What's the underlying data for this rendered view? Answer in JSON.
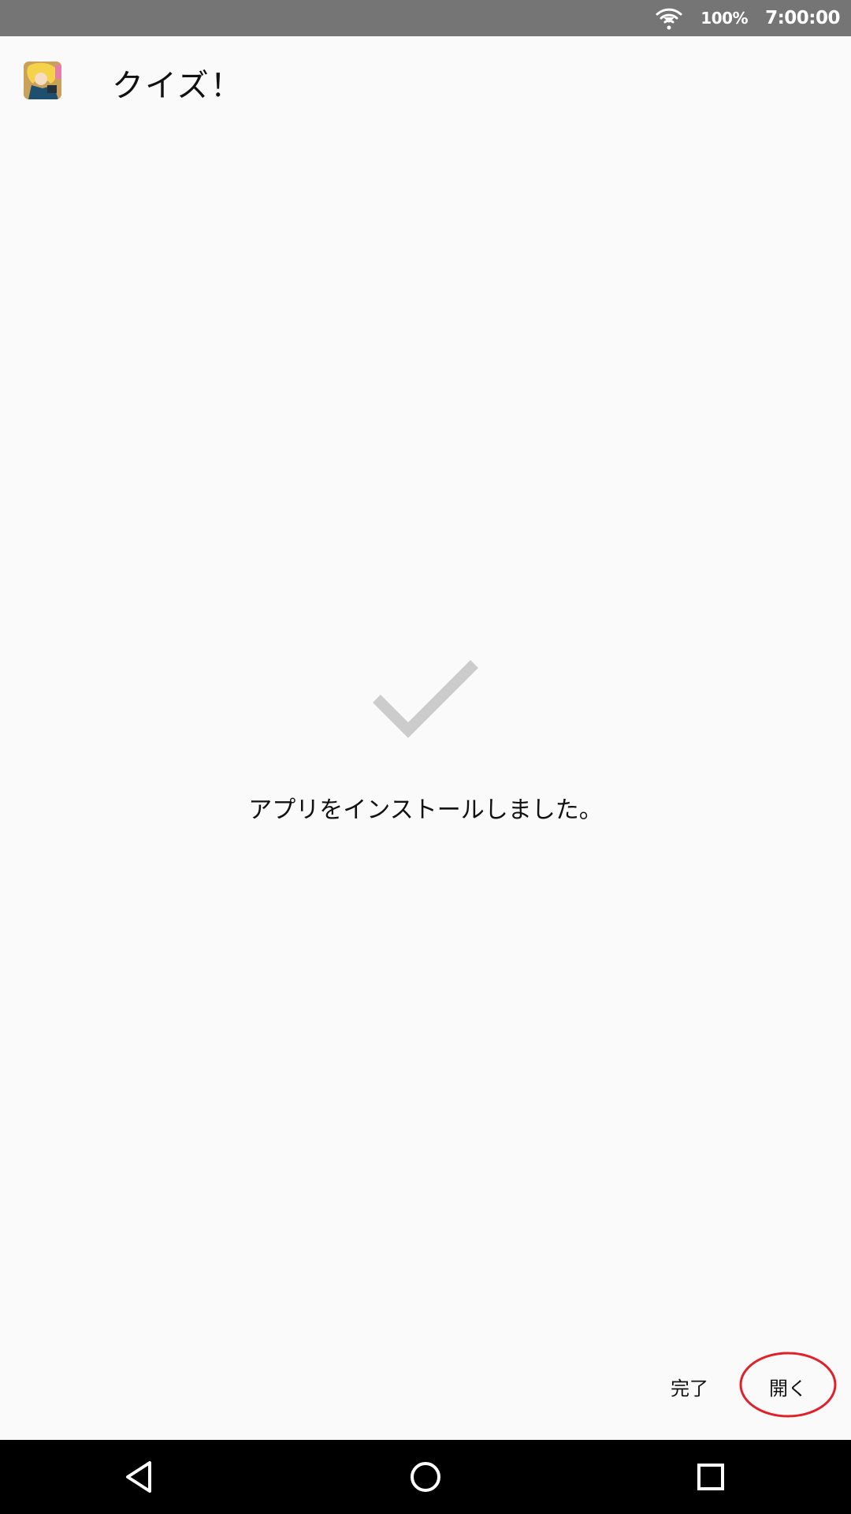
{
  "status_bar": {
    "battery": "100%",
    "time": "7:00:00",
    "icons": [
      "wifi-icon"
    ]
  },
  "header": {
    "app_icon": "app-icon",
    "title": "クイズ！"
  },
  "main": {
    "icon": "check-icon",
    "message": "アプリをインストールしました。"
  },
  "actions": {
    "done_label": "完了",
    "open_label": "開く",
    "highlight_color": "#e0212b"
  },
  "nav_bar": {
    "icons": [
      "back-icon",
      "home-icon",
      "recents-icon"
    ]
  }
}
